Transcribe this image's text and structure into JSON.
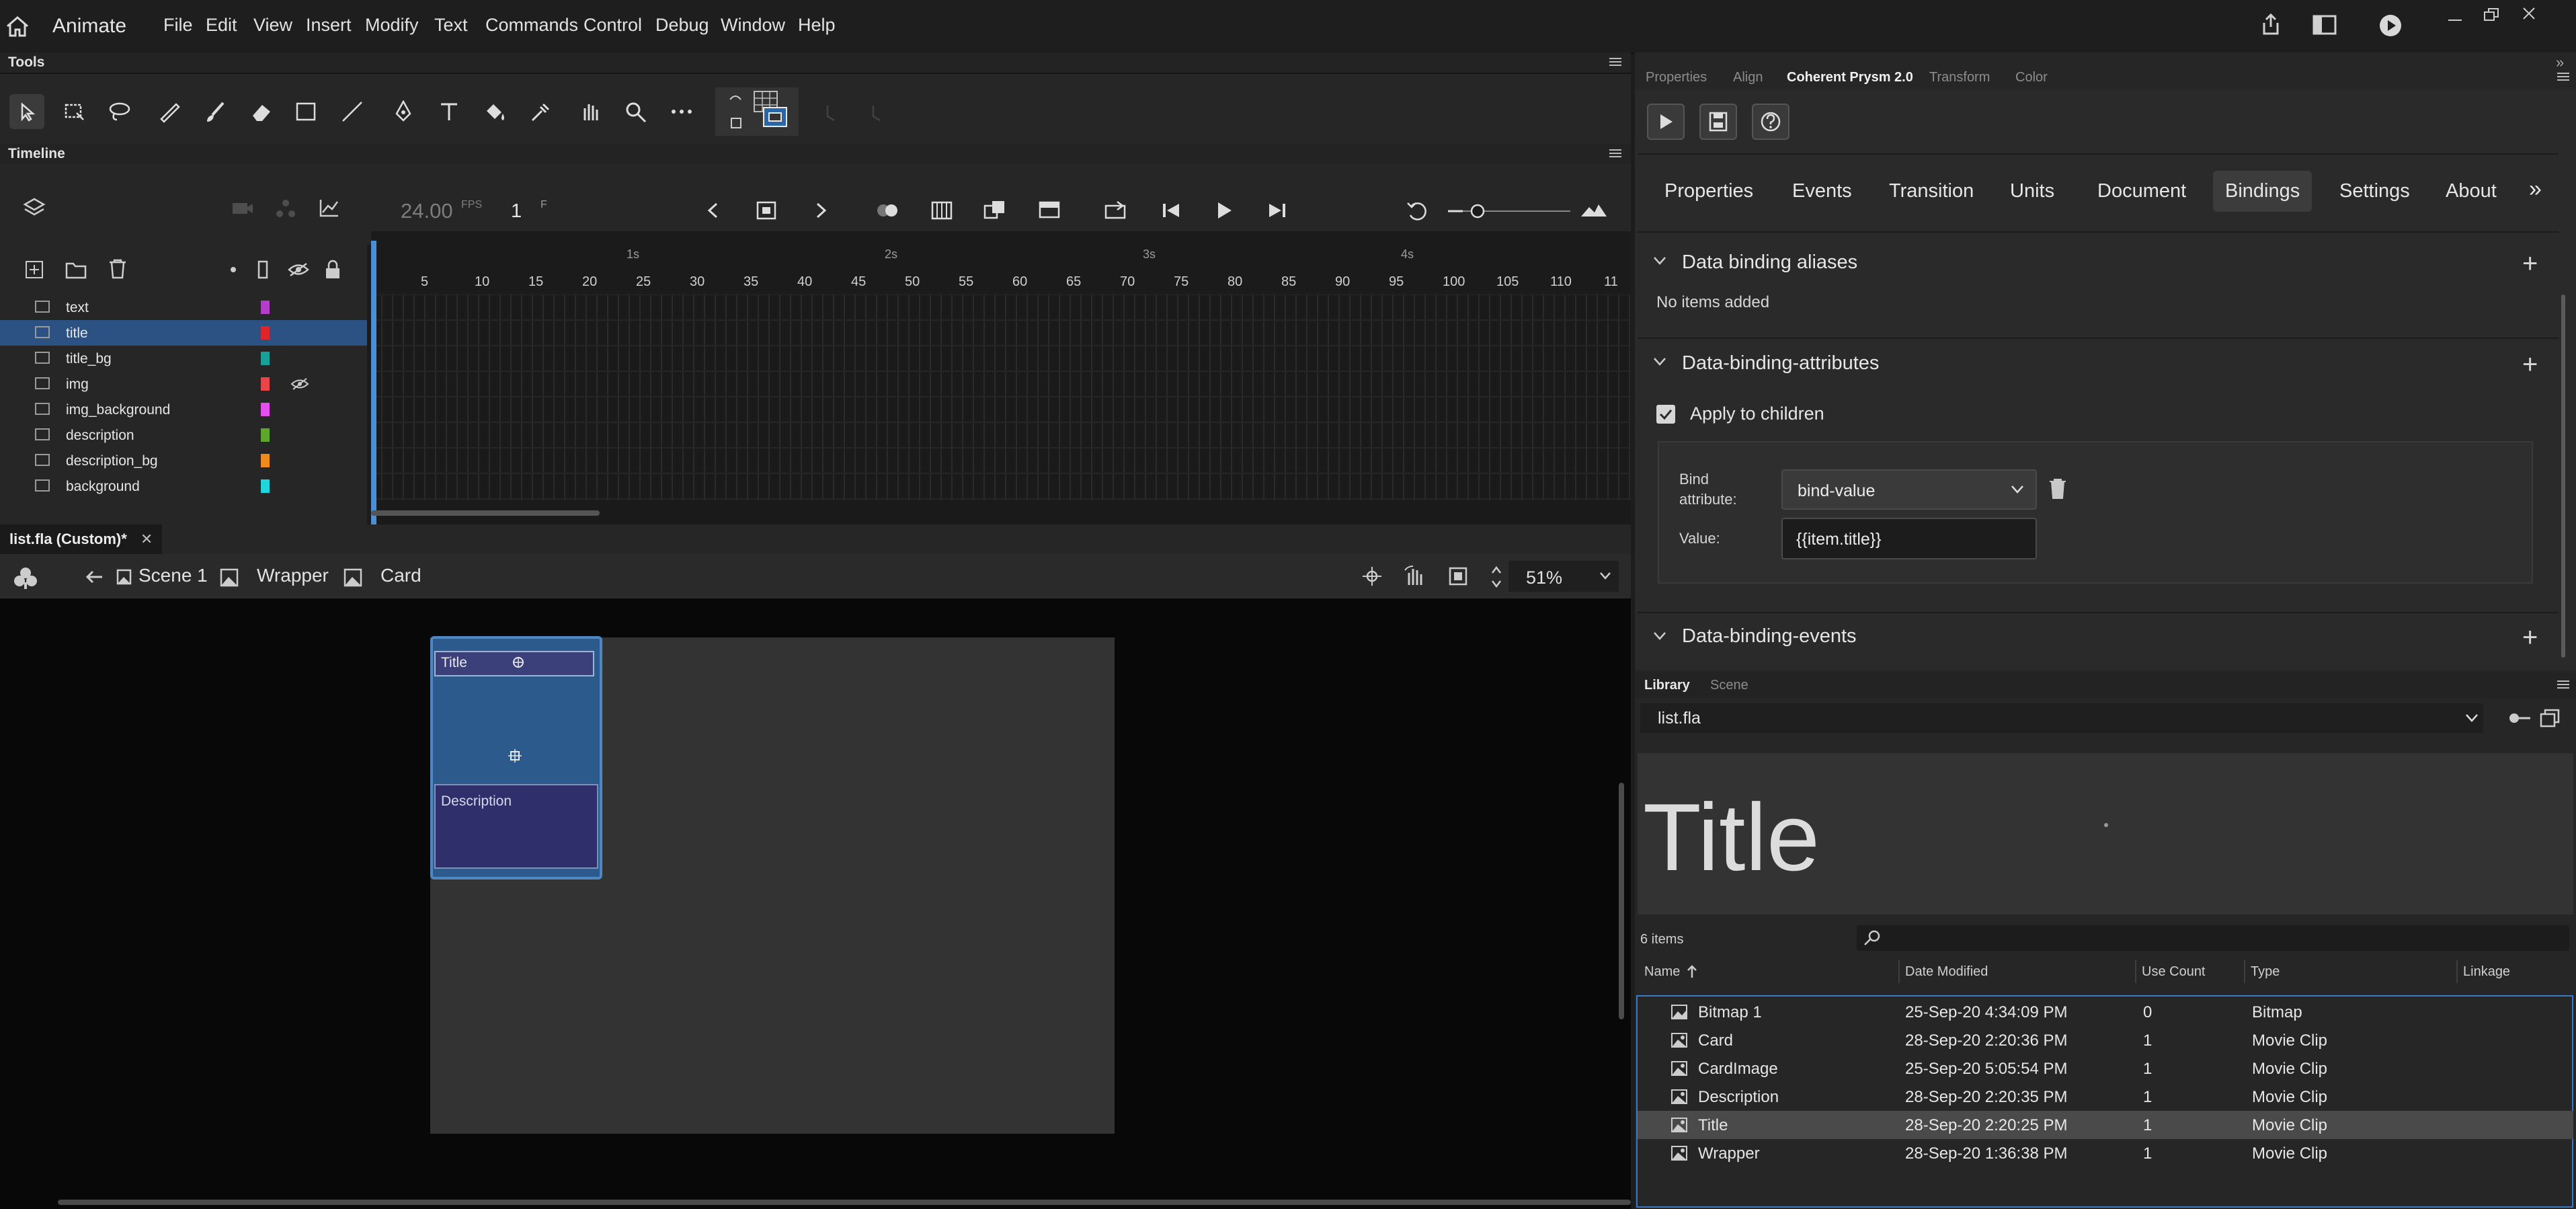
{
  "app": {
    "name": "Animate"
  },
  "menu": [
    "File",
    "Edit",
    "View",
    "Insert",
    "Modify",
    "Text",
    "Commands",
    "Control",
    "Debug",
    "Window",
    "Help"
  ],
  "tools": {
    "panel_title": "Tools"
  },
  "timeline": {
    "panel_title": "Timeline",
    "fps": "24.00",
    "fps_unit": "FPS",
    "frame": "1",
    "frame_unit": "F",
    "ruler_seconds": [
      "1s",
      "2s",
      "3s",
      "4s"
    ],
    "ruler_frames": [
      "5",
      "10",
      "15",
      "20",
      "25",
      "30",
      "35",
      "40",
      "45",
      "50",
      "55",
      "60",
      "65",
      "70",
      "75",
      "80",
      "85",
      "90",
      "95",
      "100",
      "105",
      "110",
      "11"
    ],
    "layers": [
      {
        "name": "text",
        "color": "#b23ec9"
      },
      {
        "name": "title",
        "color": "#e0242b"
      },
      {
        "name": "title_bg",
        "color": "#18a196"
      },
      {
        "name": "img",
        "color": "#e8444a"
      },
      {
        "name": "img_background",
        "color": "#e54ff0"
      },
      {
        "name": "description",
        "color": "#5ea72d"
      },
      {
        "name": "description_bg",
        "color": "#f08a1d"
      },
      {
        "name": "background",
        "color": "#1fd6dc"
      }
    ]
  },
  "document": {
    "tab": "list.fla (Custom)*",
    "breadcrumbs": [
      "Scene 1",
      "Wrapper",
      "Card"
    ],
    "zoom": "51%",
    "card_title": "Title",
    "card_description": "Description"
  },
  "right_panel": {
    "tabs": [
      "Properties",
      "Align",
      "Coherent Prysm 2.0",
      "Transform",
      "Color"
    ],
    "active_tab": "Coherent Prysm 2.0",
    "plugin_tabs": [
      "Properties",
      "Events",
      "Transition",
      "Units",
      "Document",
      "Bindings",
      "Settings",
      "About"
    ],
    "active_plugin_tab": "Bindings",
    "more": "»",
    "sections": {
      "aliases_title": "Data binding aliases",
      "aliases_empty": "No items added",
      "attributes_title": "Data-binding-attributes",
      "apply_children": "Apply to children",
      "bind_attribute_label_1": "Bind",
      "bind_attribute_label_2": "attribute:",
      "bind_attribute_value": "bind-value",
      "value_label": "Value:",
      "value": "{{item.title}}",
      "events_title": "Data-binding-events"
    }
  },
  "library": {
    "tabs": [
      "Library",
      "Scene"
    ],
    "file": "list.fla",
    "preview_text": "Title",
    "count": "6 items",
    "search_placeholder": "",
    "columns": [
      "Name",
      "Date Modified",
      "Use Count",
      "Type",
      "Linkage"
    ],
    "items": [
      {
        "name": "Bitmap 1",
        "date": "25-Sep-20 4:34:09 PM",
        "count": "0",
        "type": "Bitmap",
        "icon": "bitmap-icon"
      },
      {
        "name": "Card",
        "date": "28-Sep-20 2:20:36 PM",
        "count": "1",
        "type": "Movie Clip",
        "icon": "movieclip-icon"
      },
      {
        "name": "CardImage",
        "date": "25-Sep-20 5:05:54 PM",
        "count": "1",
        "type": "Movie Clip",
        "icon": "movieclip-icon"
      },
      {
        "name": "Description",
        "date": "28-Sep-20 2:20:35 PM",
        "count": "1",
        "type": "Movie Clip",
        "icon": "movieclip-icon"
      },
      {
        "name": "Title",
        "date": "28-Sep-20 2:20:25 PM",
        "count": "1",
        "type": "Movie Clip",
        "icon": "movieclip-icon",
        "selected": true
      },
      {
        "name": "Wrapper",
        "date": "28-Sep-20 1:36:38 PM",
        "count": "1",
        "type": "Movie Clip",
        "icon": "movieclip-icon"
      }
    ]
  },
  "colors": {
    "accent": "#2c5283",
    "card": "#2d5a8c",
    "stage": "#333333"
  }
}
